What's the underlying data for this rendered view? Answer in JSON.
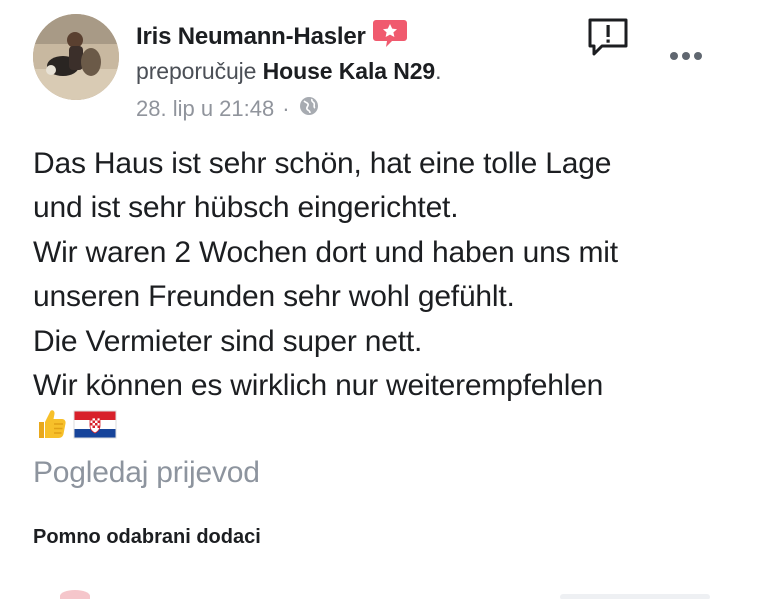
{
  "post": {
    "author": "Iris Neumann-Hasler",
    "recommend_verb": "preporučuje",
    "place": "House Kala N29",
    "place_suffix": ".",
    "timestamp": "28. lip u 21:48",
    "separator": "·",
    "privacy_icon": "globe-icon",
    "badge_icon": "recommend-star-icon",
    "badge_color": "#f05a6e",
    "body_lines": [
      "Das Haus ist sehr schön, hat eine tolle Lage",
      "und ist sehr hübsch eingerichtet.",
      "Wir waren 2 Wochen dort und haben uns mit",
      "unseren Freunden sehr wohl gefühlt.",
      "Die Vermieter sind super nett.",
      "Wir können es wirklich nur weiterempfehlen"
    ],
    "emojis": [
      "thumbs-up-icon",
      "croatia-flag-icon"
    ],
    "translate_label": "Pogledaj prijevod",
    "actions": {
      "report_icon": "report-icon",
      "more_icon": "more-options-icon"
    }
  },
  "section": {
    "title": "Pomno odabrani dodaci"
  }
}
